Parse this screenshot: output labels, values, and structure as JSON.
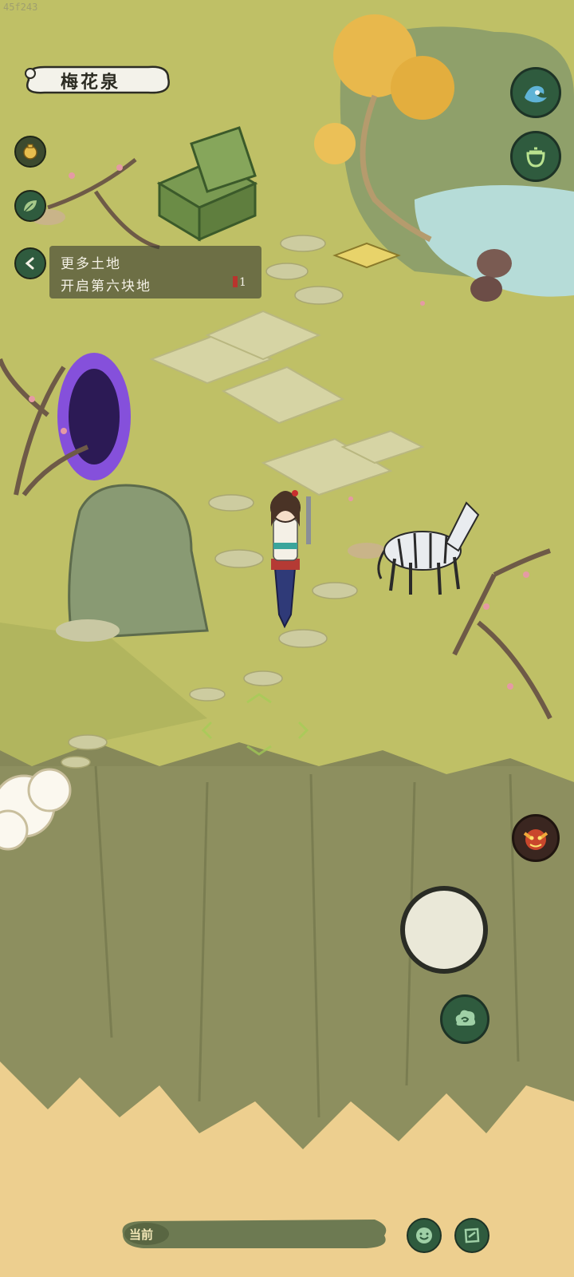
{
  "overlay": {
    "session_code": "45f243"
  },
  "location": {
    "name": "梅花泉"
  },
  "quest": {
    "title": "更多土地",
    "desc": "开启第六块地",
    "progress": "1"
  },
  "chat": {
    "channel_label": "当前"
  },
  "icons": {
    "top_right": [
      "wave-icon",
      "pot-icon"
    ],
    "left_side": [
      "money-bag-icon",
      "leaf-icon",
      "back-chevron-icon"
    ],
    "right_lower": [
      "demon-face-icon",
      "joystick-button",
      "cloud-swirl-icon"
    ],
    "bottom": [
      "smile-icon",
      "tag-icon"
    ]
  },
  "colors": {
    "grass": "#bfc066",
    "cliff": "#8f9162",
    "sand": "#edcf8f",
    "portal": "#7a3cf0",
    "accent_green": "#2f5b3e"
  }
}
